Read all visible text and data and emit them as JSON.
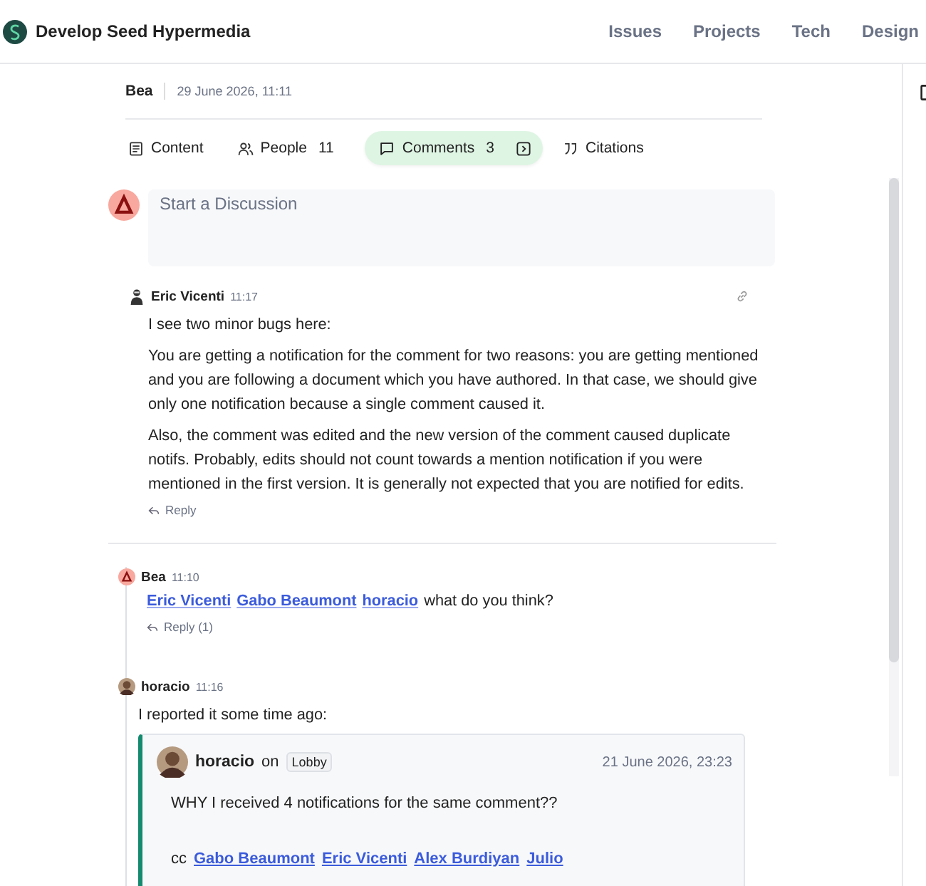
{
  "site": {
    "name": "Develop Seed Hypermedia"
  },
  "nav": [
    {
      "label": "Issues"
    },
    {
      "label": "Projects"
    },
    {
      "label": "Tech"
    },
    {
      "label": "Design"
    }
  ],
  "document": {
    "author": "Bea",
    "date": "29 June 2026, 11:11"
  },
  "tabs": [
    {
      "kind": "content",
      "label": "Content",
      "selected": false
    },
    {
      "kind": "people",
      "label": "People",
      "count": "11",
      "selected": false
    },
    {
      "kind": "comments",
      "label": "Comments",
      "count": "3",
      "selected": true
    },
    {
      "kind": "citations",
      "label": "Citations",
      "selected": false
    }
  ],
  "composer": {
    "placeholder": "Start a Discussion"
  },
  "comments": [
    {
      "avatar": {
        "kind": "person"
      },
      "author": "Eric Vicenti",
      "time": "11:17",
      "paragraphs": [
        "I see two minor bugs here:",
        "You are getting a notification for the comment for two reasons: you are getting mentioned and you are following a document which you have authored. In that case, we should give only one notification because a single comment caused it.",
        "Also, the comment was edited and the new version of the comment caused duplicate notifs. Probably, edits should not count towards a mention notification if you were mentioned in the first version. It is generally not expected that you are notified for edits."
      ],
      "reply": "Reply"
    },
    {
      "avatar": {
        "kind": "logo"
      },
      "author": "Bea",
      "time": "11:10",
      "mentions": [
        "Eric Vicenti",
        "Gabo Beaumont",
        "horacio"
      ],
      "text": "what do you think?",
      "reply": "Reply (1)",
      "children": [
        {
          "avatar": {
            "kind": "photo"
          },
          "author": "horacio",
          "time": "11:16",
          "paragraphs": [
            "I reported it some time ago:"
          ],
          "embed": {
            "author": "horacio",
            "on": "on",
            "place": "Lobby",
            "date": "21 June 2026, 23:23",
            "text": "WHY I received 4 notifications for the same comment??",
            "cc": "cc",
            "links": [
              "Gabo Beaumont",
              "Eric Vicenti",
              "Alex Burdiyan",
              "Julio"
            ]
          }
        }
      ]
    }
  ]
}
